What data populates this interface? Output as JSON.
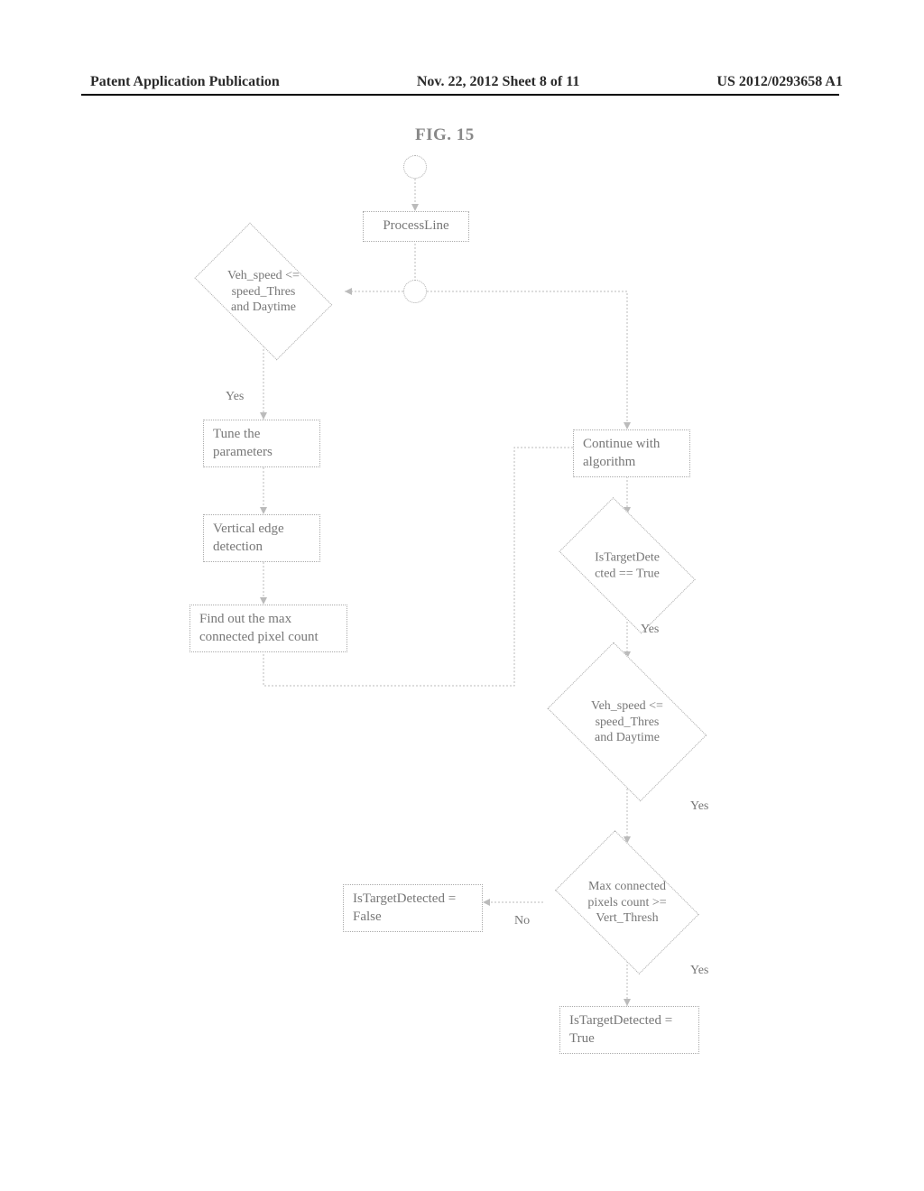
{
  "header": {
    "left": "Patent Application Publication",
    "center": "Nov. 22, 2012  Sheet 8 of 11",
    "right": "US 2012/0293658 A1"
  },
  "figure_label": "FIG. 15",
  "flow": {
    "process_line": "ProcessLine",
    "dec_speed1": "Veh_speed <=\nspeed_Thres\nand Daytime",
    "yes1": "Yes",
    "tune": "Tune the\nparameters",
    "vedge": "Vertical edge\ndetection",
    "findmax": "Find out the max\nconnected pixel count",
    "continue": "Continue with\nalgorithm",
    "dec_target": "IsTargetDete\ncted == True",
    "yes2": "Yes",
    "dec_speed2": "Veh_speed <=\nspeed_Thres\nand Daytime",
    "yes3": "Yes",
    "dec_maxpix": "Max connected\npixels count >=\nVert_Thresh",
    "no": "No",
    "res_false": "IsTargetDetected =\nFalse",
    "yes4": "Yes",
    "res_true": "IsTargetDetected =\nTrue"
  }
}
